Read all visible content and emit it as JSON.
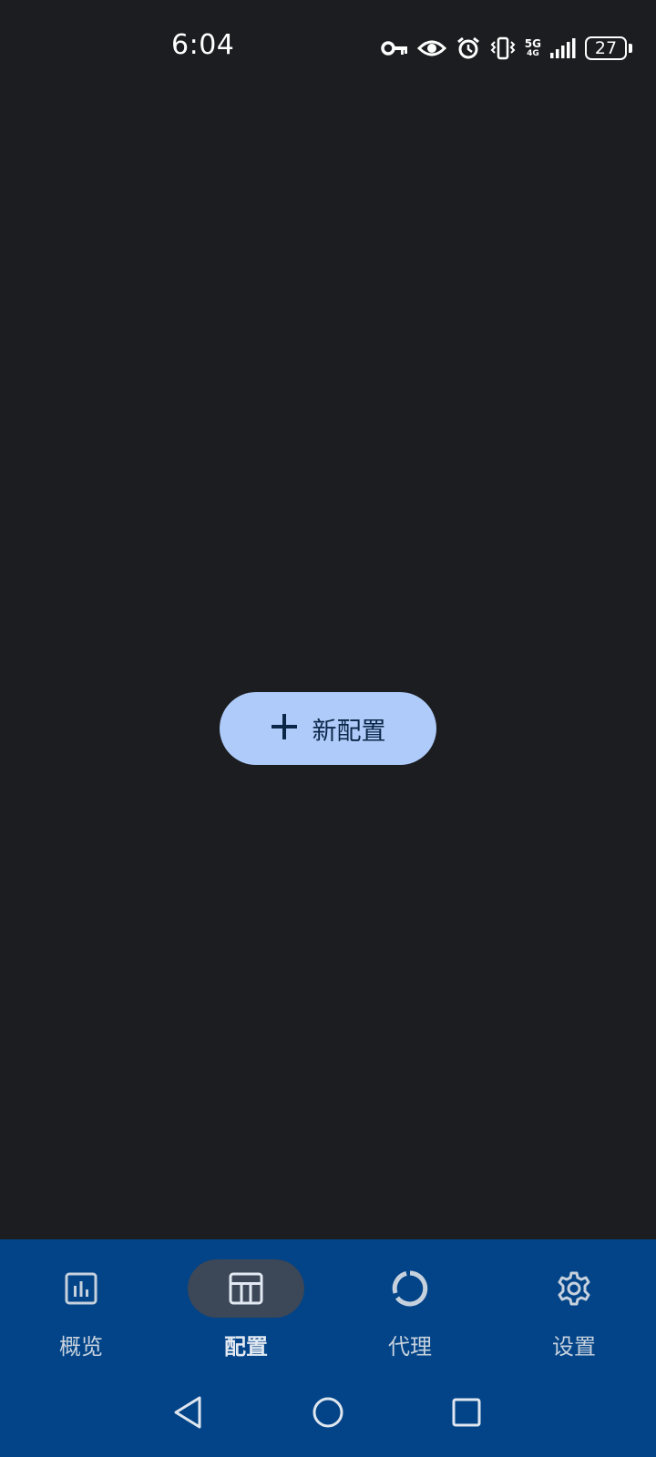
{
  "status_bar": {
    "time": "6:04",
    "network": "5G",
    "network_sub": "4G",
    "battery": "27",
    "icons": [
      "vpn-key-icon",
      "eye-icon",
      "alarm-icon",
      "vibrate-icon",
      "signal-icon",
      "battery-icon"
    ]
  },
  "main": {
    "new_config_label": "新配置",
    "new_config_icon": "plus-icon"
  },
  "bottom_nav": {
    "items": [
      {
        "label": "概览",
        "icon": "bar-chart-icon",
        "active": false
      },
      {
        "label": "配置",
        "icon": "table-layout-icon",
        "active": true
      },
      {
        "label": "代理",
        "icon": "donut-icon",
        "active": false
      },
      {
        "label": "设置",
        "icon": "gear-icon",
        "active": false
      }
    ]
  },
  "system_nav": {
    "icons": [
      "back-triangle-icon",
      "home-circle-icon",
      "recents-square-icon"
    ]
  },
  "colors": {
    "background": "#1c1d21",
    "button_bg": "#aecbfa",
    "button_text": "#0b2748",
    "nav_bg": "#024487",
    "nav_indicator": "#3c4758"
  }
}
